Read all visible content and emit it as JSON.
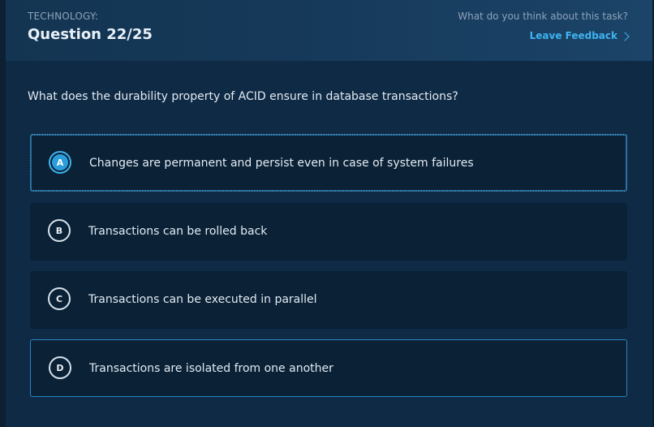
{
  "header": {
    "category": "TECHNOLOGY:",
    "question_number": "Question 22/25",
    "feedback_prompt": "What do you think about this task?",
    "feedback_link": "Leave Feedback"
  },
  "question": {
    "text": "What does the durability property of ACID ensure in database transactions?"
  },
  "options": [
    {
      "letter": "A",
      "text": "Changes are permanent and persist even in case of system failures",
      "state": "selected"
    },
    {
      "letter": "B",
      "text": "Transactions can be rolled back",
      "state": "default"
    },
    {
      "letter": "C",
      "text": "Transactions can be executed in parallel",
      "state": "default"
    },
    {
      "letter": "D",
      "text": "Transactions are isolated from one another",
      "state": "outlined"
    }
  ],
  "colors": {
    "accent": "#3fb4f0",
    "background": "#0f2a45",
    "option_background": "#0a2136"
  },
  "icons": {
    "feedback_link": "chevron-right-icon"
  }
}
